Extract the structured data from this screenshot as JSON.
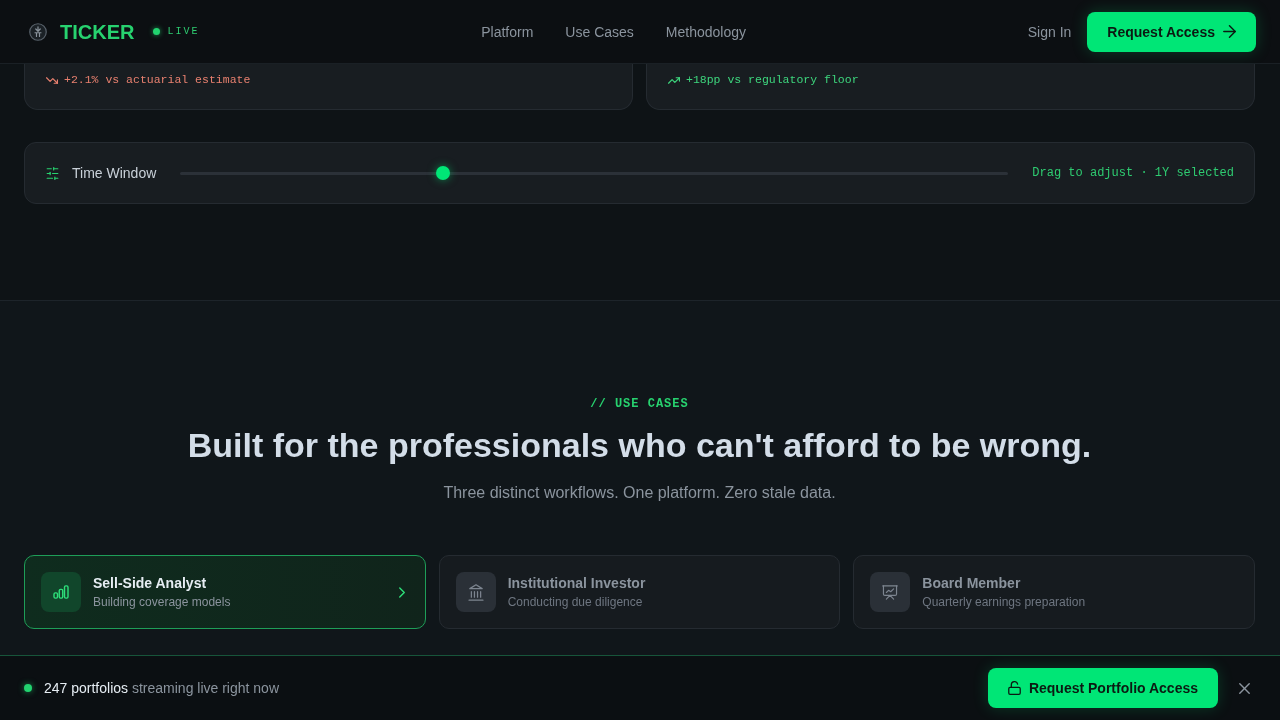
{
  "header": {
    "logo": "TICKER",
    "status": "LIVE",
    "nav": [
      "Platform",
      "Use Cases",
      "Methodology"
    ],
    "sign_in": "Sign In",
    "cta": "Request Access"
  },
  "stat_cards": [
    {
      "kind": "down",
      "delta": "+2.1% vs actuarial estimate"
    },
    {
      "kind": "up",
      "delta": "+18pp vs regulatory floor"
    }
  ],
  "time_window": {
    "label": "Time Window",
    "level": 0.317,
    "hint": "Drag to adjust · 1Y selected"
  },
  "use_cases": {
    "eyebrow": "// USE CASES",
    "title": "Built for the professionals who can't afford to be wrong.",
    "subtitle": "Three distinct workflows. One platform. Zero stale data.",
    "cards": [
      {
        "title": "Sell-Side Analyst",
        "subtitle": "Building coverage models",
        "selected": true
      },
      {
        "title": "Institutional Investor",
        "subtitle": "Conducting due diligence",
        "selected": false
      },
      {
        "title": "Board Member",
        "subtitle": "Quarterly earnings preparation",
        "selected": false
      }
    ]
  },
  "banner": {
    "message": "**247 portfolios** streaming live right now",
    "cta": "Request Portfolio Access"
  }
}
